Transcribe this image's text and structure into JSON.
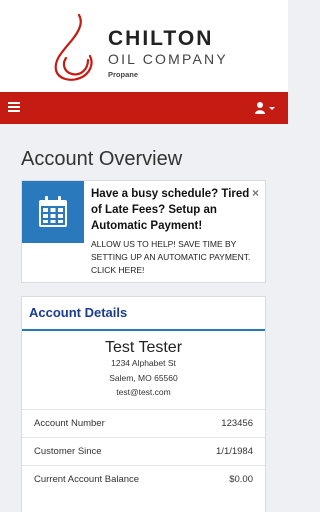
{
  "brand": {
    "name": "CHILTON",
    "line2": "OIL COMPANY",
    "line3": "Propane",
    "accent": "#c41c12"
  },
  "nav": {
    "menu_icon": "hamburger-menu-icon",
    "user_icon": "user-icon"
  },
  "page": {
    "title": "Account Overview"
  },
  "promo": {
    "icon": "calendar-icon",
    "close": "×",
    "heading": "Have a busy schedule? Tired of Late Fees? Setup an Automatic Payment!",
    "body": "ALLOW US TO HELP! SAVE TIME BY SETTING UP AN AUTOMATIC PAYMENT. CLICK HERE!"
  },
  "account": {
    "section_title": "Account Details",
    "customer_name": "Test Tester",
    "address_line1": "1234 Alphabet St",
    "address_line2": "Salem, MO 65560",
    "email": "test@test.com",
    "rows": [
      {
        "label": "Account Number",
        "value": "123456"
      },
      {
        "label": "Customer Since",
        "value": "1/1/1984"
      },
      {
        "label": "Current Account Balance",
        "value": "$0.00"
      }
    ]
  }
}
